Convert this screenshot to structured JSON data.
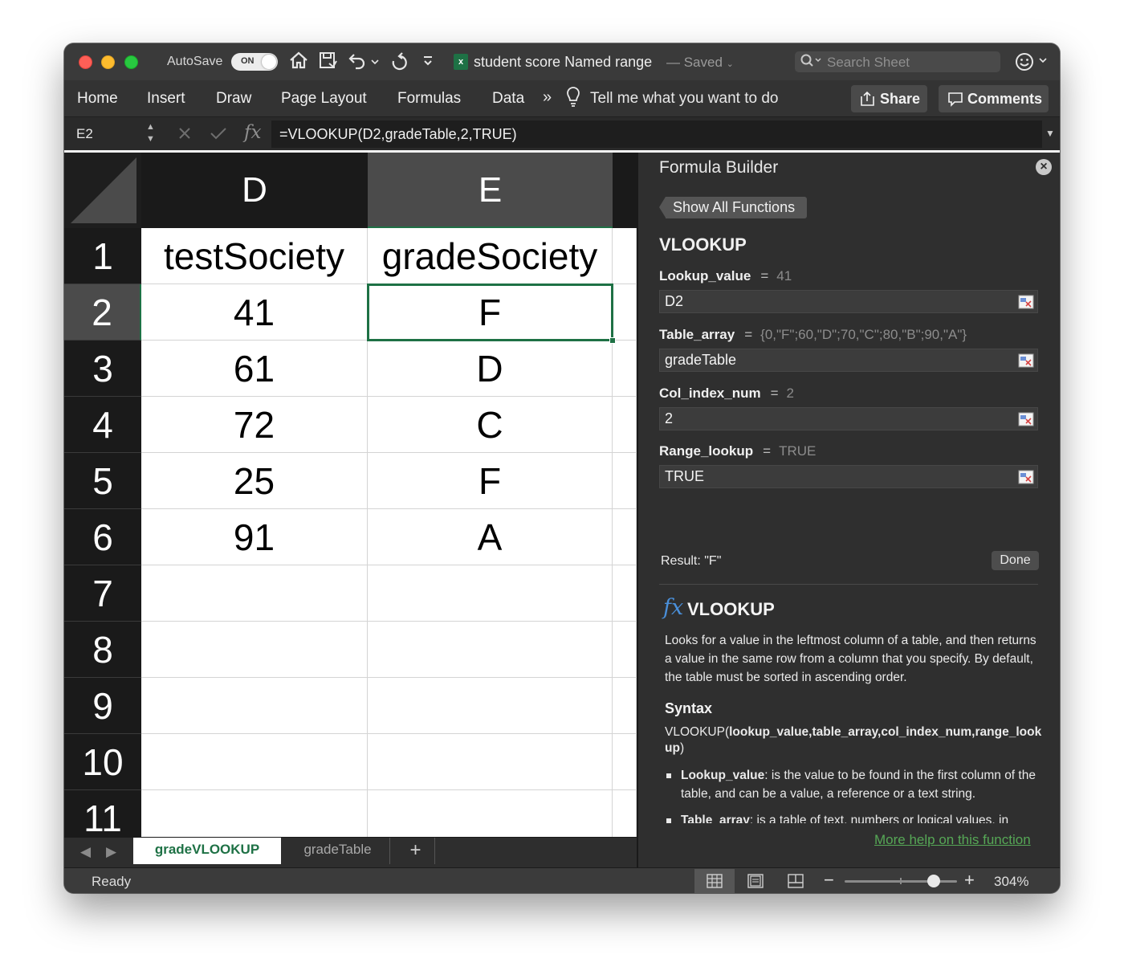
{
  "titlebar": {
    "autosave_label": "AutoSave",
    "autosave_state": "ON",
    "document_title": "student score Named range",
    "document_status": "— Saved",
    "search_placeholder": "Search Sheet",
    "icons": [
      "home-icon",
      "save-icon",
      "undo-icon",
      "redo-icon",
      "customize-toolbar-icon",
      "smiley-feedback-icon"
    ]
  },
  "ribbon": {
    "tabs": [
      "Home",
      "Insert",
      "Draw",
      "Page Layout",
      "Formulas",
      "Data"
    ],
    "more": "»",
    "tell_me": "Tell me what you want to do",
    "share_label": "Share",
    "comments_label": "Comments"
  },
  "formula_bar": {
    "name_box": "E2",
    "fx_label": "fx",
    "formula": "=VLOOKUP(D2,gradeTable,2,TRUE)"
  },
  "grid": {
    "columns": [
      "D",
      "E"
    ],
    "selected_column": "E",
    "rows": [
      "1",
      "2",
      "3",
      "4",
      "5",
      "6",
      "7",
      "8",
      "9",
      "10",
      "11"
    ],
    "selected_row": "2",
    "selected_cell": "E2",
    "cells": [
      [
        "testSociety",
        "gradeSociety"
      ],
      [
        "41",
        "F"
      ],
      [
        "61",
        "D"
      ],
      [
        "72",
        "C"
      ],
      [
        "25",
        "F"
      ],
      [
        "91",
        "A"
      ],
      [
        "",
        ""
      ],
      [
        "",
        ""
      ],
      [
        "",
        ""
      ],
      [
        "",
        ""
      ],
      [
        "",
        ""
      ]
    ],
    "selection_color": "#1e7145"
  },
  "sheet_tabs": {
    "tabs": [
      "gradeVLOOKUP",
      "gradeTable"
    ],
    "active": "gradeVLOOKUP",
    "add_label": "+"
  },
  "status_bar": {
    "status": "Ready",
    "zoom": "304%",
    "zoom_slider_fraction": 0.79,
    "views": [
      "normal-view-icon",
      "page-layout-view-icon",
      "page-break-view-icon"
    ]
  },
  "formula_builder": {
    "title": "Formula Builder",
    "show_all_label": "Show All Functions",
    "function_name": "VLOOKUP",
    "args": [
      {
        "name": "Lookup_value",
        "eq": "=",
        "evaluated": "41",
        "input": "D2"
      },
      {
        "name": "Table_array",
        "eq": "=",
        "evaluated": "{0,\"F\";60,\"D\";70,\"C\";80,\"B\";90,\"A\"}",
        "input": "gradeTable"
      },
      {
        "name": "Col_index_num",
        "eq": "=",
        "evaluated": "2",
        "input": "2"
      },
      {
        "name": "Range_lookup",
        "eq": "=",
        "evaluated": "TRUE",
        "input": "TRUE"
      }
    ],
    "result": "Result: \"F\"",
    "done_label": "Done",
    "help": {
      "fx": "fx",
      "title": "VLOOKUP",
      "description": "Looks for a value in the leftmost column of a table, and then returns a value in the same row from a column that you specify. By default, the table must be sorted in ascending order.",
      "syntax_heading": "Syntax",
      "syntax_prefix": "VLOOKUP(",
      "syntax_args": "lookup_value,table_array,col_index_num,range_lookup",
      "syntax_suffix": ")",
      "bullets": [
        {
          "term": "Lookup_value",
          "text": ": is the value to be found in the first column of the table, and can be a value, a reference or a text string."
        },
        {
          "term": "Table_array",
          "text": ": is a table of text, numbers or logical values, in"
        }
      ],
      "more_help": "More help on this function"
    }
  }
}
